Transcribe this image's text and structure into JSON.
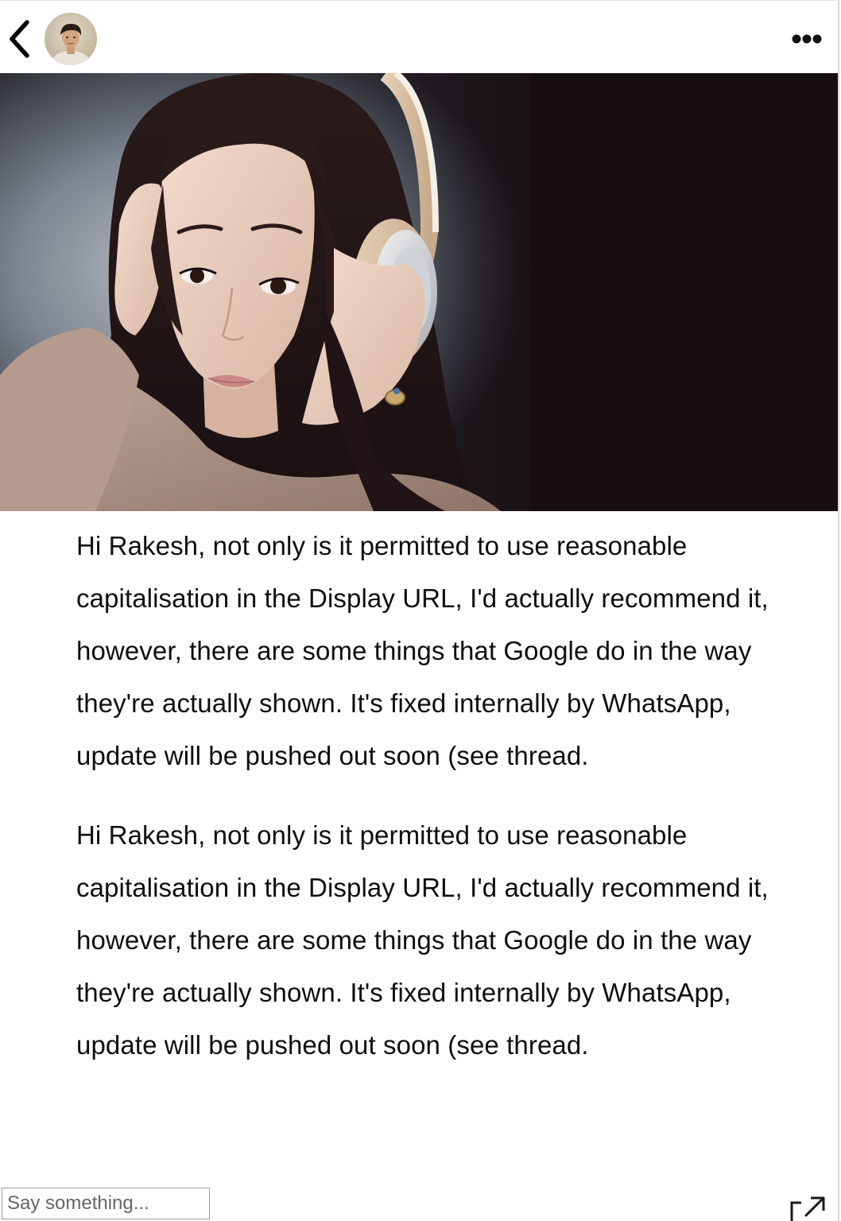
{
  "header": {
    "back_icon": "chevron-left-icon",
    "avatar_icon": "user-avatar-icon",
    "more_icon": "ellipsis-icon"
  },
  "hero_image": {
    "icon": "photo-woman-headphones"
  },
  "messages": [
    {
      "text": "Hi Rakesh, not only is it permitted to use reasonable capitalisation in the Display URL, I'd actually recommend it, however, there are some things that Google do in the way they're actually shown. It's fixed internally by WhatsApp, update will be pushed out soon (see thread."
    },
    {
      "text": "Hi Rakesh, not only is it permitted to use reasonable capitalisation in the Display URL, I'd actually recommend it, however, there are some things that Google do in the way they're actually shown. It's fixed internally by WhatsApp, update will be pushed out soon (see thread."
    }
  ],
  "composer": {
    "placeholder": "Say something...",
    "value": ""
  },
  "footer": {
    "share_icon": "external-link-icon"
  }
}
